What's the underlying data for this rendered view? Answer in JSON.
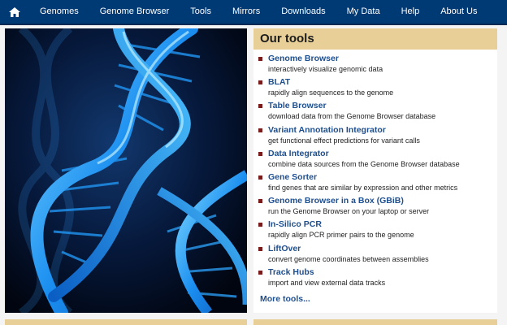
{
  "nav": {
    "home_icon": "home-icon",
    "items": [
      "Genomes",
      "Genome Browser",
      "Tools",
      "Mirrors",
      "Downloads",
      "My Data",
      "Help",
      "About Us"
    ]
  },
  "hero": {
    "image": "dna-double-helix-image"
  },
  "tools": {
    "title": "Our tools",
    "items": [
      {
        "name": "Genome Browser",
        "desc": "interactively visualize genomic data"
      },
      {
        "name": "BLAT",
        "desc": "rapidly align sequences to the genome"
      },
      {
        "name": "Table Browser",
        "desc": "download data from the Genome Browser database"
      },
      {
        "name": "Variant Annotation Integrator",
        "desc": "get functional effect predictions for variant calls"
      },
      {
        "name": "Data Integrator",
        "desc": "combine data sources from the Genome Browser database"
      },
      {
        "name": "Gene Sorter",
        "desc": "find genes that are similar by expression and other metrics"
      },
      {
        "name": "Genome Browser in a Box (GBiB)",
        "desc": "run the Genome Browser on your laptop or server"
      },
      {
        "name": "In-Silico PCR",
        "desc": "rapidly align PCR primer pairs to the genome"
      },
      {
        "name": "LiftOver",
        "desc": "convert genome coordinates between assemblies"
      },
      {
        "name": "Track Hubs",
        "desc": "import and view external data tracks"
      }
    ],
    "more_label": "More tools..."
  },
  "colors": {
    "navbar": "#003a74",
    "panel_header": "#e8cf98",
    "link": "#1e4f8e",
    "bullet": "#7a1c1c"
  }
}
